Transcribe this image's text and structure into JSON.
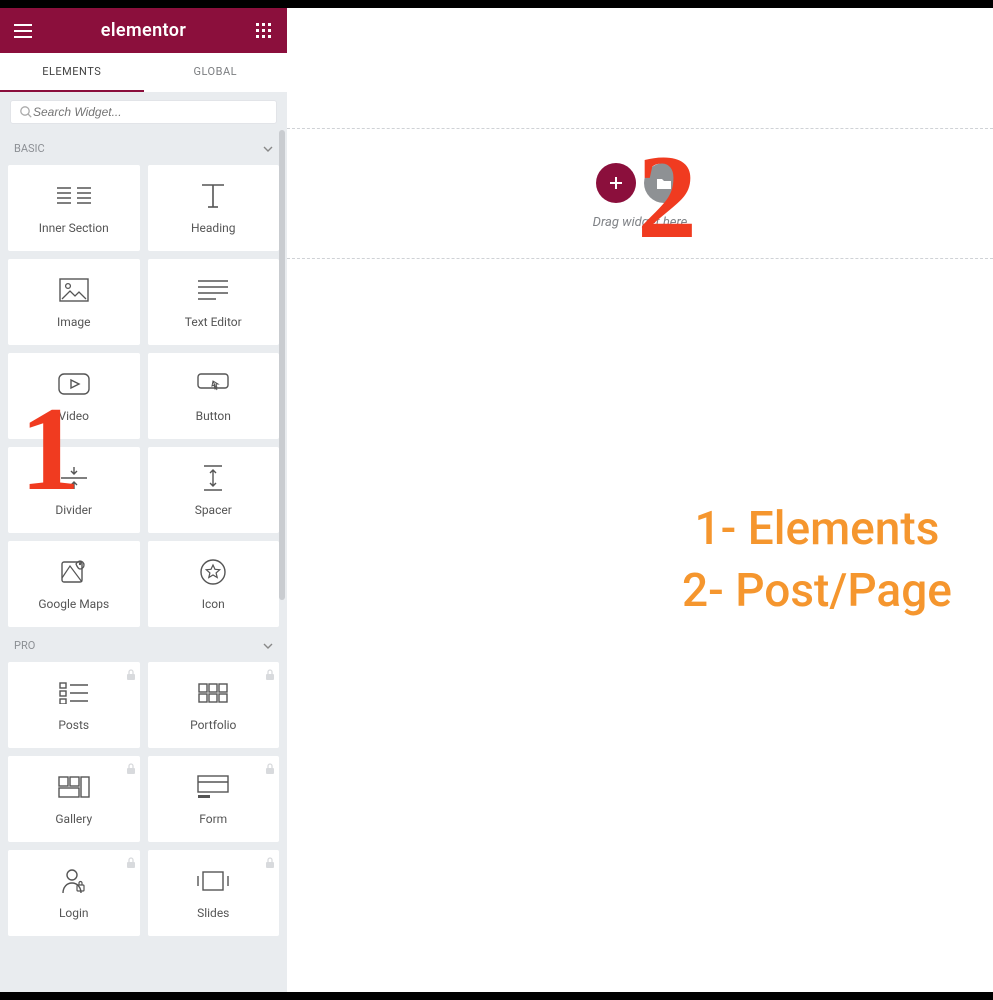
{
  "header": {
    "title": "elementor"
  },
  "tabs": {
    "elements": "ELEMENTS",
    "global": "GLOBAL"
  },
  "search": {
    "placeholder": "Search Widget..."
  },
  "groups": {
    "basic": {
      "label": "BASIC",
      "widgets": [
        {
          "label": "Inner Section",
          "icon": "inner-section"
        },
        {
          "label": "Heading",
          "icon": "heading"
        },
        {
          "label": "Image",
          "icon": "image"
        },
        {
          "label": "Text Editor",
          "icon": "text-editor"
        },
        {
          "label": "Video",
          "icon": "video"
        },
        {
          "label": "Button",
          "icon": "button"
        },
        {
          "label": "Divider",
          "icon": "divider"
        },
        {
          "label": "Spacer",
          "icon": "spacer"
        },
        {
          "label": "Google Maps",
          "icon": "google-maps"
        },
        {
          "label": "Icon",
          "icon": "star"
        }
      ]
    },
    "pro": {
      "label": "PRO",
      "widgets": [
        {
          "label": "Posts",
          "icon": "posts",
          "locked": true
        },
        {
          "label": "Portfolio",
          "icon": "portfolio",
          "locked": true
        },
        {
          "label": "Gallery",
          "icon": "gallery",
          "locked": true
        },
        {
          "label": "Form",
          "icon": "form",
          "locked": true
        },
        {
          "label": "Login",
          "icon": "login",
          "locked": true
        },
        {
          "label": "Slides",
          "icon": "slides",
          "locked": true
        }
      ]
    }
  },
  "canvas": {
    "drag_hint": "Drag widget here"
  },
  "annotations": {
    "one": "1",
    "two": "2",
    "legend_line1": "1- Elements",
    "legend_line2": "2- Post/Page"
  }
}
